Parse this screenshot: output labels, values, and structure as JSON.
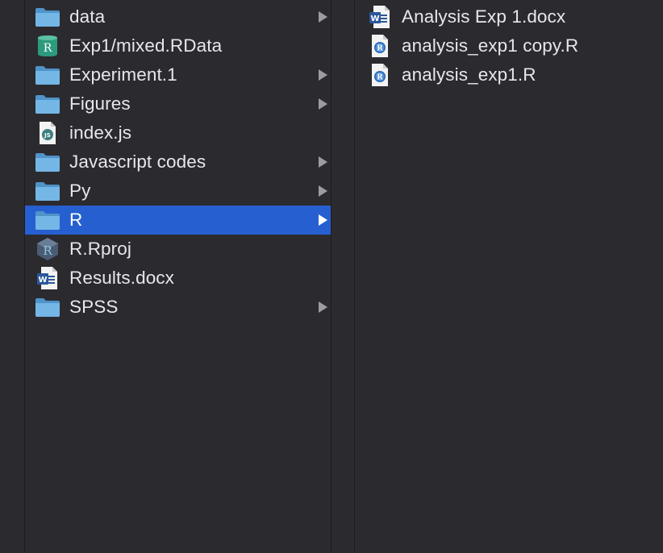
{
  "left_column": {
    "items": [
      {
        "label": "data",
        "icon": "folder-icon",
        "has_children": true,
        "selected": false
      },
      {
        "label": "Exp1/mixed.RData",
        "icon": "rdata-file-icon",
        "has_children": false,
        "selected": false
      },
      {
        "label": "Experiment.1",
        "icon": "folder-icon",
        "has_children": true,
        "selected": false
      },
      {
        "label": "Figures",
        "icon": "folder-icon",
        "has_children": true,
        "selected": false
      },
      {
        "label": "index.js",
        "icon": "js-file-icon",
        "has_children": false,
        "selected": false
      },
      {
        "label": "Javascript codes",
        "icon": "folder-icon",
        "has_children": true,
        "selected": false
      },
      {
        "label": "Py",
        "icon": "folder-icon",
        "has_children": true,
        "selected": false
      },
      {
        "label": "R",
        "icon": "folder-icon",
        "has_children": true,
        "selected": true
      },
      {
        "label": "R.Rproj",
        "icon": "rproj-file-icon",
        "has_children": false,
        "selected": false
      },
      {
        "label": "Results.docx",
        "icon": "word-doc-icon",
        "has_children": false,
        "selected": false
      },
      {
        "label": "SPSS",
        "icon": "folder-icon",
        "has_children": true,
        "selected": false
      }
    ]
  },
  "right_column": {
    "items": [
      {
        "label": "Analysis Exp 1.docx",
        "icon": "word-doc-icon"
      },
      {
        "label": "analysis_exp1 copy.R",
        "icon": "r-script-icon"
      },
      {
        "label": "analysis_exp1.R",
        "icon": "r-script-icon"
      }
    ]
  },
  "colors": {
    "background": "#2b2a2f",
    "selection": "#2660d0",
    "text": "#e7e7ea",
    "folder": "#6fb1e0"
  }
}
